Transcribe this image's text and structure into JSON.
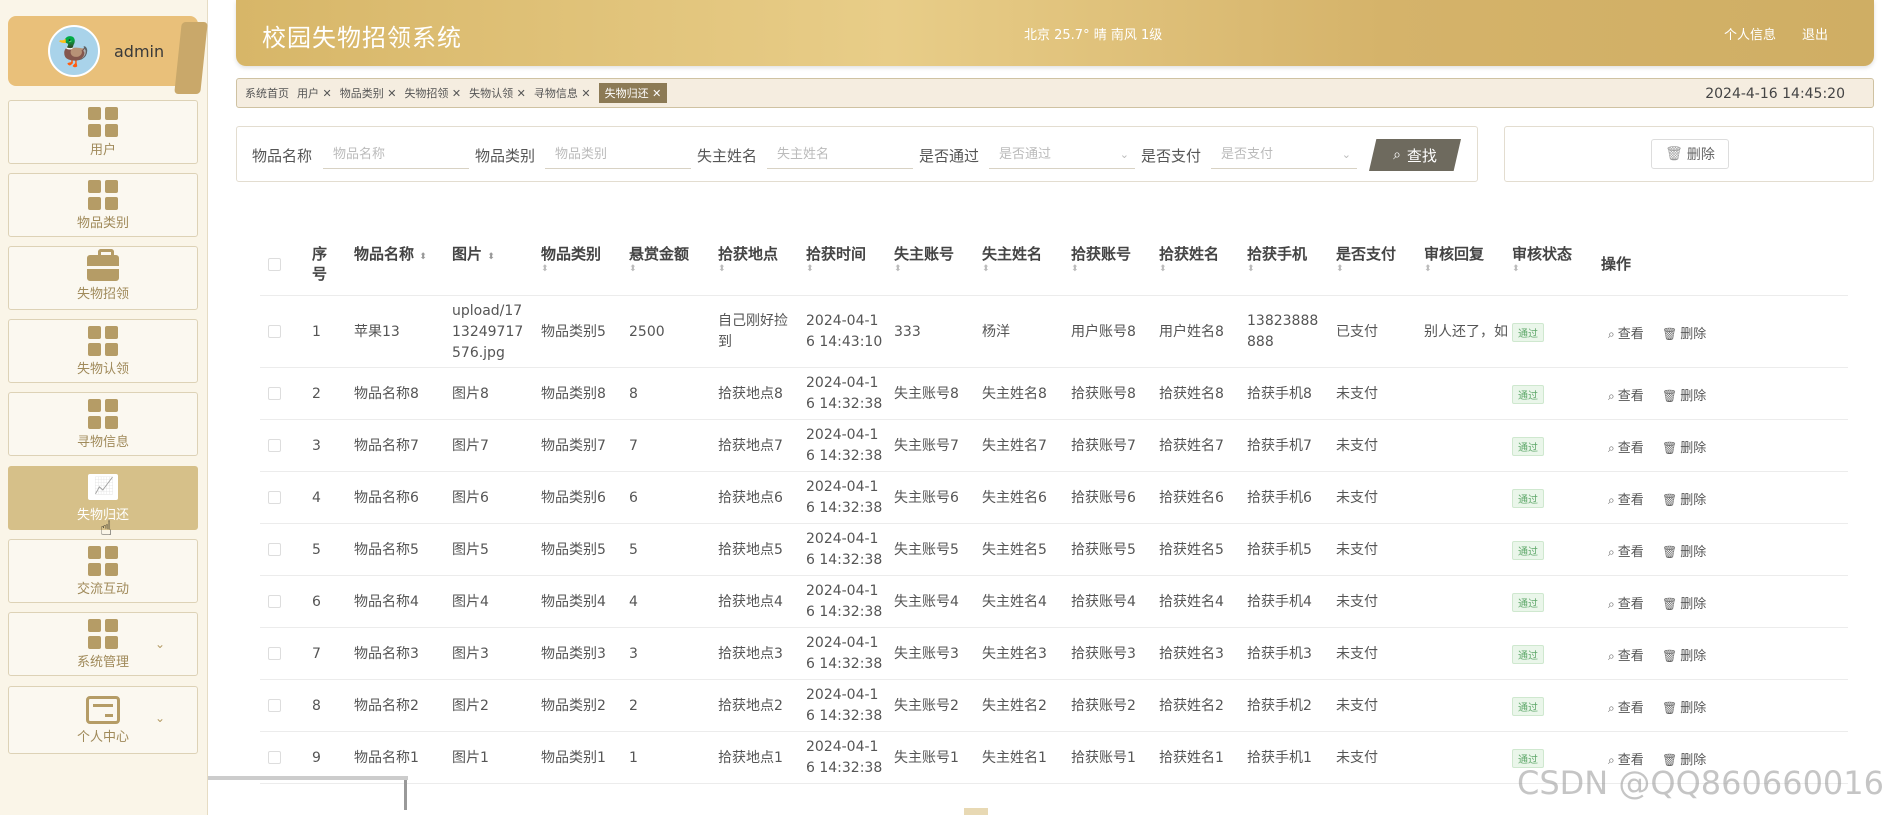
{
  "user": {
    "name": "admin"
  },
  "sidebar": {
    "items": [
      {
        "label": "用户",
        "icon": "grid-icon"
      },
      {
        "label": "物品类别",
        "icon": "grid-icon"
      },
      {
        "label": "失物招领",
        "icon": "briefcase-icon"
      },
      {
        "label": "失物认领",
        "icon": "grid-icon"
      },
      {
        "label": "寻物信息",
        "icon": "grid-icon"
      },
      {
        "label": "失物归还",
        "icon": "chart-icon",
        "active": true
      },
      {
        "label": "交流互动",
        "icon": "grid-icon"
      },
      {
        "label": "系统管理",
        "icon": "grid-icon",
        "expandable": true
      },
      {
        "label": "个人中心",
        "icon": "card-icon",
        "expandable": true
      }
    ]
  },
  "header": {
    "title": "校园失物招领系统",
    "weather": "北京  25.7°  晴  南风  1级",
    "profile_link": "个人信息",
    "logout_link": "退出"
  },
  "tabs": {
    "items": [
      "系统首页",
      "用户 ✕",
      "物品类别 ✕",
      "失物招领 ✕",
      "失物认领 ✕",
      "寻物信息 ✕",
      "失物归还 ✕"
    ],
    "datetime": "2024-4-16 14:45:20"
  },
  "search": {
    "item_name_label": "物品名称",
    "item_name_placeholder": "物品名称",
    "category_label": "物品类别",
    "category_placeholder": "物品类别",
    "owner_label": "失主姓名",
    "owner_placeholder": "失主姓名",
    "approved_label": "是否通过",
    "approved_placeholder": "是否通过",
    "paid_label": "是否支付",
    "paid_placeholder": "是否支付",
    "find_button": "查找",
    "delete_button": "删除"
  },
  "table": {
    "headers": {
      "index": "序号",
      "name": "物品名称",
      "image": "图片",
      "category": "物品类别",
      "reward": "悬赏金额",
      "place": "拾获地点",
      "time": "拾获时间",
      "owner_account": "失主账号",
      "owner_name": "失主姓名",
      "finder_account": "拾获账号",
      "finder_name": "拾获姓名",
      "finder_phone": "拾获手机",
      "paid": "是否支付",
      "reply": "审核回复",
      "status": "审核状态",
      "actions": "操作"
    },
    "view_label": "查看",
    "delete_label": "删除",
    "rows": [
      {
        "index": "1",
        "name": "苹果13",
        "image": [
          "upload/17",
          "13249717",
          "576.jpg"
        ],
        "category": "物品类别5",
        "reward": "2500",
        "place": [
          "自己刚好捡",
          "到"
        ],
        "time": [
          "2024-04-1",
          "6 14:43:10"
        ],
        "owner_account": "333",
        "owner_name": "杨洋",
        "finder_account": "用户账号8",
        "finder_name": "用户姓名8",
        "finder_phone": [
          "13823888",
          "888"
        ],
        "paid": "已支付",
        "reply": "别人还了，如",
        "status": "通过"
      },
      {
        "index": "2",
        "name": "物品名称8",
        "image": [
          "图片8"
        ],
        "category": "物品类别8",
        "reward": "8",
        "place": [
          "拾获地点8"
        ],
        "time": [
          "2024-04-1",
          "6 14:32:38"
        ],
        "owner_account": "失主账号8",
        "owner_name": "失主姓名8",
        "finder_account": "拾获账号8",
        "finder_name": "拾获姓名8",
        "finder_phone": [
          "拾获手机8"
        ],
        "paid": "未支付",
        "reply": "",
        "status": "通过"
      },
      {
        "index": "3",
        "name": "物品名称7",
        "image": [
          "图片7"
        ],
        "category": "物品类别7",
        "reward": "7",
        "place": [
          "拾获地点7"
        ],
        "time": [
          "2024-04-1",
          "6 14:32:38"
        ],
        "owner_account": "失主账号7",
        "owner_name": "失主姓名7",
        "finder_account": "拾获账号7",
        "finder_name": "拾获姓名7",
        "finder_phone": [
          "拾获手机7"
        ],
        "paid": "未支付",
        "reply": "",
        "status": "通过"
      },
      {
        "index": "4",
        "name": "物品名称6",
        "image": [
          "图片6"
        ],
        "category": "物品类别6",
        "reward": "6",
        "place": [
          "拾获地点6"
        ],
        "time": [
          "2024-04-1",
          "6 14:32:38"
        ],
        "owner_account": "失主账号6",
        "owner_name": "失主姓名6",
        "finder_account": "拾获账号6",
        "finder_name": "拾获姓名6",
        "finder_phone": [
          "拾获手机6"
        ],
        "paid": "未支付",
        "reply": "",
        "status": "通过"
      },
      {
        "index": "5",
        "name": "物品名称5",
        "image": [
          "图片5"
        ],
        "category": "物品类别5",
        "reward": "5",
        "place": [
          "拾获地点5"
        ],
        "time": [
          "2024-04-1",
          "6 14:32:38"
        ],
        "owner_account": "失主账号5",
        "owner_name": "失主姓名5",
        "finder_account": "拾获账号5",
        "finder_name": "拾获姓名5",
        "finder_phone": [
          "拾获手机5"
        ],
        "paid": "未支付",
        "reply": "",
        "status": "通过"
      },
      {
        "index": "6",
        "name": "物品名称4",
        "image": [
          "图片4"
        ],
        "category": "物品类别4",
        "reward": "4",
        "place": [
          "拾获地点4"
        ],
        "time": [
          "2024-04-1",
          "6 14:32:38"
        ],
        "owner_account": "失主账号4",
        "owner_name": "失主姓名4",
        "finder_account": "拾获账号4",
        "finder_name": "拾获姓名4",
        "finder_phone": [
          "拾获手机4"
        ],
        "paid": "未支付",
        "reply": "",
        "status": "通过"
      },
      {
        "index": "7",
        "name": "物品名称3",
        "image": [
          "图片3"
        ],
        "category": "物品类别3",
        "reward": "3",
        "place": [
          "拾获地点3"
        ],
        "time": [
          "2024-04-1",
          "6 14:32:38"
        ],
        "owner_account": "失主账号3",
        "owner_name": "失主姓名3",
        "finder_account": "拾获账号3",
        "finder_name": "拾获姓名3",
        "finder_phone": [
          "拾获手机3"
        ],
        "paid": "未支付",
        "reply": "",
        "status": "通过"
      },
      {
        "index": "8",
        "name": "物品名称2",
        "image": [
          "图片2"
        ],
        "category": "物品类别2",
        "reward": "2",
        "place": [
          "拾获地点2"
        ],
        "time": [
          "2024-04-1",
          "6 14:32:38"
        ],
        "owner_account": "失主账号2",
        "owner_name": "失主姓名2",
        "finder_account": "拾获账号2",
        "finder_name": "拾获姓名2",
        "finder_phone": [
          "拾获手机2"
        ],
        "paid": "未支付",
        "reply": "",
        "status": "通过"
      },
      {
        "index": "9",
        "name": "物品名称1",
        "image": [
          "图片1"
        ],
        "category": "物品类别1",
        "reward": "1",
        "place": [
          "拾获地点1"
        ],
        "time": [
          "2024-04-1",
          "6 14:32:38"
        ],
        "owner_account": "失主账号1",
        "owner_name": "失主姓名1",
        "finder_account": "拾获账号1",
        "finder_name": "拾获姓名1",
        "finder_phone": [
          "拾获手机1"
        ],
        "paid": "未支付",
        "reply": "",
        "status": "通过"
      }
    ]
  },
  "watermark": "CSDN @QQ860660016"
}
